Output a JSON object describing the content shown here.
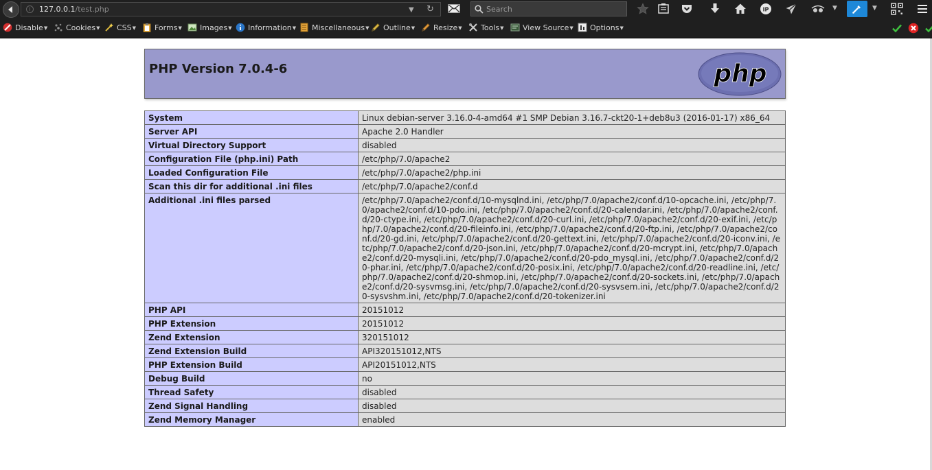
{
  "browser": {
    "url_host": "127.0.0.1",
    "url_path": "/test.php",
    "search_placeholder": "Search",
    "icons": [
      "back-arrow-icon",
      "site-info-icon",
      "dropdown-arrow-icon",
      "reload-icon",
      "envelope-icon",
      "search-icon",
      "bookmark-star-icon",
      "reading-list-icon",
      "pocket-icon",
      "download-icon",
      "home-icon",
      "ip-icon",
      "send-icon",
      "spy-glasses-icon",
      "eyedropper-icon",
      "qr-code-icon",
      "hamburger-menu-icon"
    ]
  },
  "devbar": {
    "items": [
      {
        "label": "Disable"
      },
      {
        "label": "Cookies"
      },
      {
        "label": "CSS"
      },
      {
        "label": "Forms"
      },
      {
        "label": "Images"
      },
      {
        "label": "Information"
      },
      {
        "label": "Miscellaneous"
      },
      {
        "label": "Outline"
      },
      {
        "label": "Resize"
      },
      {
        "label": "Tools"
      },
      {
        "label": "View Source"
      },
      {
        "label": "Options"
      }
    ],
    "status_icons": [
      "check-icon",
      "error-icon",
      "check-icon"
    ]
  },
  "page": {
    "title": "PHP Version 7.0.4-6",
    "logo_text": "php",
    "rows": [
      {
        "k": "System",
        "v": "Linux debian-server 3.16.0-4-amd64 #1 SMP Debian 3.16.7-ckt20-1+deb8u3 (2016-01-17) x86_64"
      },
      {
        "k": "Server API",
        "v": "Apache 2.0 Handler"
      },
      {
        "k": "Virtual Directory Support",
        "v": "disabled"
      },
      {
        "k": "Configuration File (php.ini) Path",
        "v": "/etc/php/7.0/apache2"
      },
      {
        "k": "Loaded Configuration File",
        "v": "/etc/php/7.0/apache2/php.ini"
      },
      {
        "k": "Scan this dir for additional .ini files",
        "v": "/etc/php/7.0/apache2/conf.d"
      },
      {
        "k": "Additional .ini files parsed",
        "v": "/etc/php/7.0/apache2/conf.d/10-mysqlnd.ini, /etc/php/7.0/apache2/conf.d/10-opcache.ini, /etc/php/7.0/apache2/conf.d/10-pdo.ini, /etc/php/7.0/apache2/conf.d/20-calendar.ini, /etc/php/7.0/apache2/conf.d/20-ctype.ini, /etc/php/7.0/apache2/conf.d/20-curl.ini, /etc/php/7.0/apache2/conf.d/20-exif.ini, /etc/php/7.0/apache2/conf.d/20-fileinfo.ini, /etc/php/7.0/apache2/conf.d/20-ftp.ini, /etc/php/7.0/apache2/conf.d/20-gd.ini, /etc/php/7.0/apache2/conf.d/20-gettext.ini, /etc/php/7.0/apache2/conf.d/20-iconv.ini, /etc/php/7.0/apache2/conf.d/20-json.ini, /etc/php/7.0/apache2/conf.d/20-mcrypt.ini, /etc/php/7.0/apache2/conf.d/20-mysqli.ini, /etc/php/7.0/apache2/conf.d/20-pdo_mysql.ini, /etc/php/7.0/apache2/conf.d/20-phar.ini, /etc/php/7.0/apache2/conf.d/20-posix.ini, /etc/php/7.0/apache2/conf.d/20-readline.ini, /etc/php/7.0/apache2/conf.d/20-shmop.ini, /etc/php/7.0/apache2/conf.d/20-sockets.ini, /etc/php/7.0/apache2/conf.d/20-sysvmsg.ini, /etc/php/7.0/apache2/conf.d/20-sysvsem.ini, /etc/php/7.0/apache2/conf.d/20-sysvshm.ini, /etc/php/7.0/apache2/conf.d/20-tokenizer.ini"
      },
      {
        "k": "PHP API",
        "v": "20151012"
      },
      {
        "k": "PHP Extension",
        "v": "20151012"
      },
      {
        "k": "Zend Extension",
        "v": "320151012"
      },
      {
        "k": "Zend Extension Build",
        "v": "API320151012,NTS"
      },
      {
        "k": "PHP Extension Build",
        "v": "API20151012,NTS"
      },
      {
        "k": "Debug Build",
        "v": "no"
      },
      {
        "k": "Thread Safety",
        "v": "disabled"
      },
      {
        "k": "Zend Signal Handling",
        "v": "disabled"
      },
      {
        "k": "Zend Memory Manager",
        "v": "enabled"
      }
    ]
  },
  "colors": {
    "header_bg": "#9999cc",
    "key_bg": "#ccccff",
    "value_bg": "#dddddd",
    "chrome_bg": "#1f1f1f",
    "active_tool": "#1e88d8"
  }
}
